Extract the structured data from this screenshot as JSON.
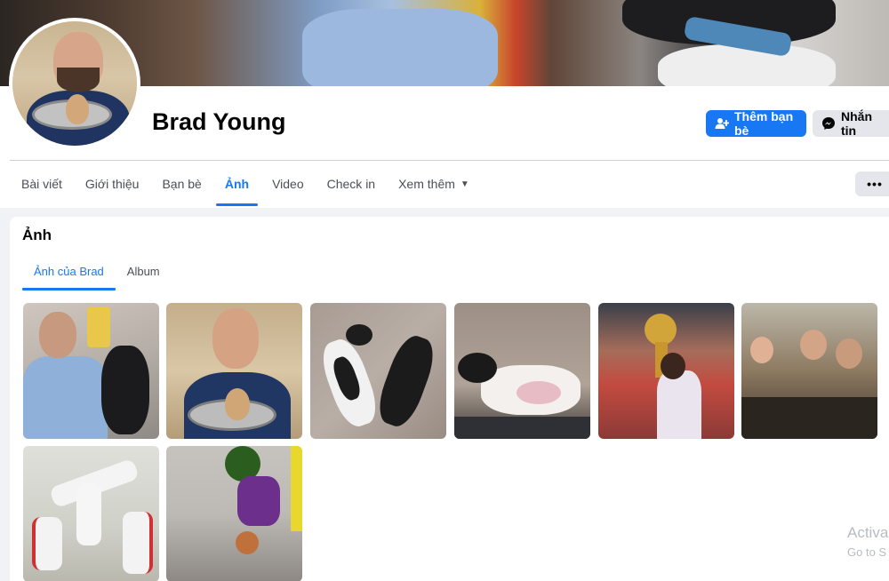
{
  "profile": {
    "name": "Brad Young"
  },
  "actions": {
    "add_friend_label": "Thêm bạn bè",
    "message_label": "Nhắn tin",
    "more_label": "•••"
  },
  "nav": {
    "items": [
      {
        "label": "Bài viết",
        "active": false
      },
      {
        "label": "Giới thiệu",
        "active": false
      },
      {
        "label": "Bạn bè",
        "active": false
      },
      {
        "label": "Ảnh",
        "active": true
      },
      {
        "label": "Video",
        "active": false
      },
      {
        "label": "Check in",
        "active": false
      },
      {
        "label": "Xem thêm",
        "active": false
      }
    ]
  },
  "photos": {
    "title": "Ảnh",
    "tabs": [
      {
        "label": "Ảnh của Brad",
        "active": true
      },
      {
        "label": "Album",
        "active": false
      }
    ],
    "count": 8
  },
  "watermark": {
    "line1": "Activa",
    "line2": "Go to S"
  },
  "colors": {
    "accent": "#1877f2",
    "background": "#f0f2f5",
    "secondary_button": "#e4e6eb"
  },
  "icons": {
    "add_friend": "add-person-icon",
    "message": "messenger-icon",
    "dropdown": "caret-down-icon"
  }
}
